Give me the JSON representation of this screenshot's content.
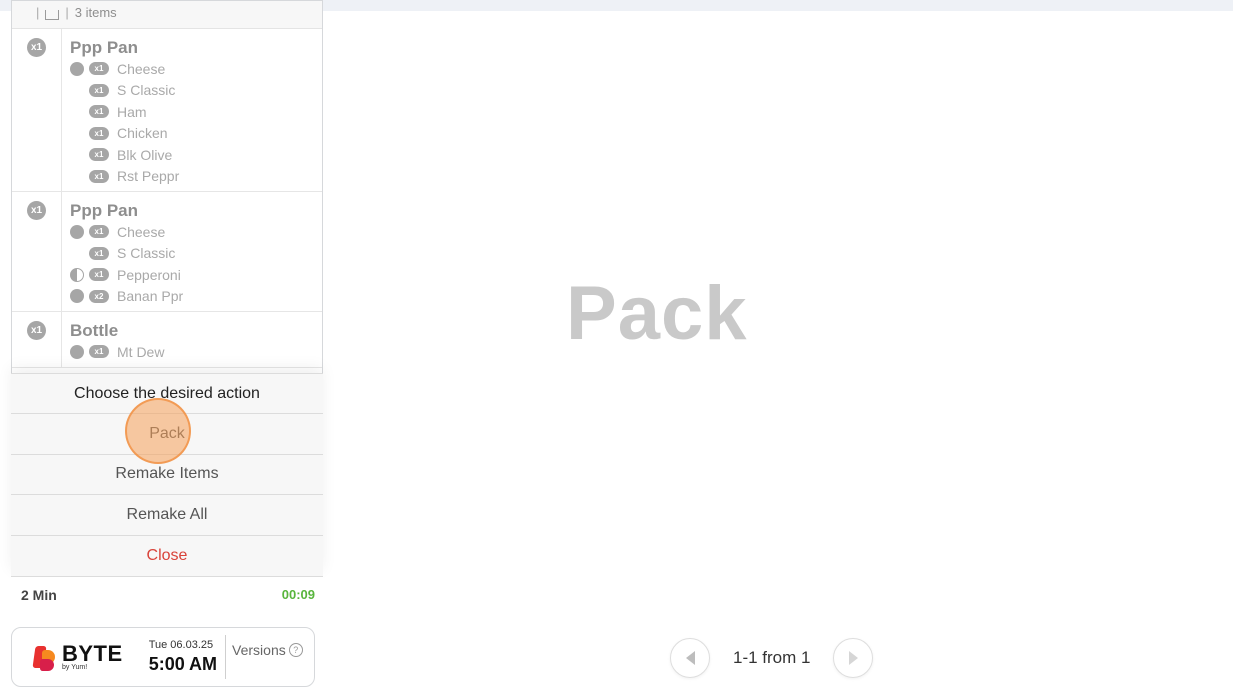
{
  "ticket": {
    "header_count": "3 items",
    "items": [
      {
        "qty": "x1",
        "name": "Ppp Pan",
        "mods": [
          {
            "dot": "full",
            "qty": "x1",
            "label": "Cheese"
          },
          {
            "dot": "none",
            "qty": "x1",
            "label": "S Classic"
          },
          {
            "dot": "none",
            "qty": "x1",
            "label": "Ham"
          },
          {
            "dot": "none",
            "qty": "x1",
            "label": "Chicken"
          },
          {
            "dot": "none",
            "qty": "x1",
            "label": "Blk Olive"
          },
          {
            "dot": "none",
            "qty": "x1",
            "label": "Rst Peppr"
          }
        ]
      },
      {
        "qty": "x1",
        "name": "Ppp Pan",
        "mods": [
          {
            "dot": "full",
            "qty": "x1",
            "label": "Cheese"
          },
          {
            "dot": "none",
            "qty": "x1",
            "label": "S Classic"
          },
          {
            "dot": "half",
            "qty": "x1",
            "label": "Pepperoni"
          },
          {
            "dot": "full",
            "qty": "x2",
            "label": "Banan Ppr"
          }
        ]
      },
      {
        "qty": "x1",
        "name": "Bottle",
        "mods": [
          {
            "dot": "full",
            "qty": "x1",
            "label": "Mt Dew"
          }
        ]
      }
    ],
    "footer_left": "2 Min",
    "footer_right": "00:09",
    "footer_right_color": "#58b53c"
  },
  "modal": {
    "title": "Choose the desired action",
    "pack": "Pack",
    "remake_items": "Remake Items",
    "remake_all": "Remake All",
    "close": "Close",
    "close_color": "#d9433a"
  },
  "brand": {
    "logo": "BYTE",
    "logo_sub": "by Yum!",
    "date": "Tue 06.03.25",
    "time": "5:00 AM",
    "versions": "Versions",
    "help_glyph": "?"
  },
  "main": {
    "title": "Pack"
  },
  "pager": {
    "text": "1-1 from 1"
  }
}
